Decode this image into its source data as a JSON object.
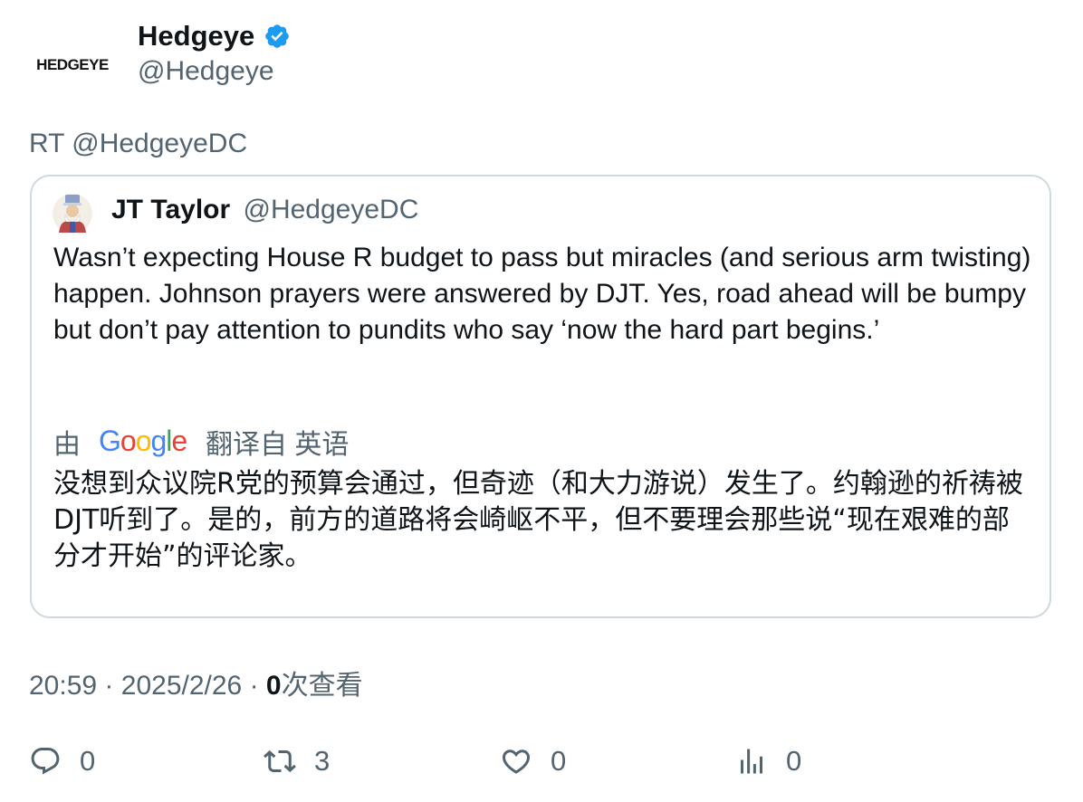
{
  "author": {
    "avatar_text": "HEDGEYE",
    "display_name": "Hedgeye",
    "handle": "@Hedgeye",
    "verified": true,
    "verified_color": "#1d9bf0"
  },
  "retweet_line": "RT @HedgeyeDC",
  "quoted": {
    "name": "JT Taylor",
    "handle": "@HedgeyeDC",
    "text": "Wasn’t expecting House R budget to pass but miracles (and serious arm twisting) happen. Johnson prayers were answered by DJT. Yes, road ahead will be bumpy but don’t pay attention to pundits who say ‘now the hard part begins.’",
    "translate_prefix": "由",
    "translate_provider": "Google",
    "translate_suffix": "翻译自 英语",
    "translation": "没想到众议院R党的预算会通过，但奇迹（和大力游说）发生了。约翰逊的祈祷被DJT听到了。是的，前方的道路将会崎岖不平，但不要理会那些说“现在艰难的部分才开始”的评论家。"
  },
  "meta": {
    "time": "20:59",
    "date": "2025/2/26",
    "separator": "·",
    "views_count": "0",
    "views_label": "次查看"
  },
  "actions": {
    "reply_count": "0",
    "retweet_count": "3",
    "like_count": "0",
    "views_count": "0"
  },
  "colors": {
    "text_primary": "#0f1419",
    "text_secondary": "#536471",
    "border": "#cfd9de",
    "google_blue": "#4285f4",
    "google_red": "#ea4335",
    "google_yellow": "#fbbc05",
    "google_green": "#34a853"
  },
  "icons": [
    "verified-badge-icon",
    "reply-icon",
    "retweet-icon",
    "like-icon",
    "views-icon"
  ]
}
